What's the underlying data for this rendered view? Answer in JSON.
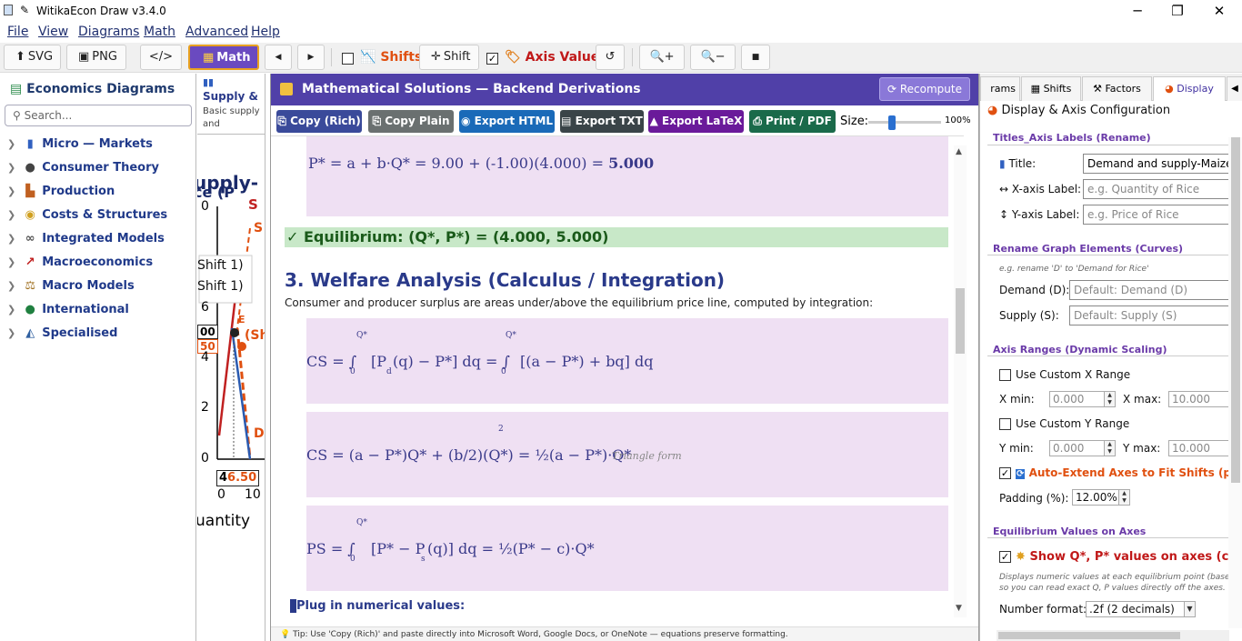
{
  "window": {
    "title": "WitikaEcon Draw  v3.4.0"
  },
  "menu": [
    "File",
    "View",
    "Diagrams",
    "Math",
    "Advanced",
    "Help"
  ],
  "toolbar": {
    "svg": "SVG",
    "png": "PNG",
    "code": "</>",
    "math": "Math",
    "shifts": "Shifts",
    "shift": "Shift",
    "axis_values": "Axis Values"
  },
  "sidebar": {
    "title": "Economics Diagrams",
    "search_placeholder": "Search...",
    "items": [
      {
        "label": "Micro — Markets",
        "icon": "bar-chart-icon"
      },
      {
        "label": "Consumer Theory",
        "icon": "person-icon"
      },
      {
        "label": "Production",
        "icon": "factory-icon"
      },
      {
        "label": "Costs & Structures",
        "icon": "coins-icon"
      },
      {
        "label": "Integrated Models",
        "icon": "link-icon"
      },
      {
        "label": "Macroeconomics",
        "icon": "trend-chart-icon"
      },
      {
        "label": "Macro Models",
        "icon": "scales-icon"
      },
      {
        "label": "International",
        "icon": "globe-icon"
      },
      {
        "label": "Specialised",
        "icon": "area-chart-icon"
      }
    ]
  },
  "diagram_strip": {
    "card_title": "Supply &",
    "card_desc1": "Basic supply",
    "card_desc2": "and",
    "chart_title_frag": "upply-",
    "chart_title_frag2": "ce (P",
    "legend1": "Shift 1)",
    "legend2": "Shift 1)",
    "label_s": "S",
    "label_s2": "S",
    "label_e1": "E",
    "label_sh": "(Sh",
    "label_d": "D",
    "y_ticks": [
      "0",
      "2",
      "4",
      "6"
    ],
    "y_tick_top": "0",
    "val_00": "00",
    "val_50": "50",
    "val_650": "6.50",
    "val_4": "4",
    "x_ticks": [
      "0",
      "10"
    ],
    "x_label": "uantity"
  },
  "math": {
    "header": "Mathematical Solutions  —  Backend Derivations",
    "recompute": "Recompute",
    "actions": [
      "Copy (Rich)",
      "Copy Plain",
      "Export HTML",
      "Export TXT",
      "Export LaTeX",
      "Print / PDF"
    ],
    "size_label": "Size:",
    "size_pct": "100%",
    "p_eq": "P* = a + b·Q* = 9.00 + (-1.00)(4.000) = ",
    "p_eq_bold": "5.000",
    "equilibrium": "✓ Equilibrium: (Q*, P*) = (4.000, 5.000)",
    "section3_title": "3. Welfare Analysis (Calculus / Integration)",
    "section3_desc": "Consumer and producer surplus are areas under/above the equilibrium price line, computed by integration:",
    "cs1_main": "CS = ∫",
    "cs1_a": "[P",
    "cs1_b": "(q) − P*] dq = ∫",
    "cs1_c": "[(a − P*) + bq] dq",
    "cs2_main": "CS = (a − P*)Q* + (b/2)(Q*)",
    "cs2_b": " = ½(a − P*)·Q*",
    "cs2_note": "Triangle form",
    "ps_main": "PS = ∫",
    "ps_a": "[P* − P",
    "ps_b": "(q)] dq = ½(P* − c)·Q*",
    "sup_q": "Q*",
    "sub_0": "0",
    "sub_d": "d",
    "sub_s": "s",
    "sup_2": "2",
    "plug": "Plug in numerical values:",
    "tip": "Tip: Use 'Copy (Rich)' and paste directly into Microsoft Word, Google Docs, or OneNote — equations preserve formatting."
  },
  "right": {
    "tabs": [
      "rams",
      "Shifts",
      "Factors",
      "Display"
    ],
    "title": "Display & Axis Configuration",
    "g1": "Titles_Axis Labels (Rename)",
    "title_lbl": "Title:",
    "title_val": "Demand and supply-Maize in",
    "xlbl": "↔ X-axis Label:",
    "xlbl_ph": "e.g. Quantity of Rice",
    "ylbl": "↕ Y-axis Label:",
    "ylbl_ph": "e.g. Price of Rice",
    "g2": "Rename Graph Elements (Curves)",
    "g2_hint": "e.g. rename 'D' to 'Demand for Rice'",
    "demand_lbl": "Demand (D):",
    "demand_ph": "Default: Demand (D)",
    "supply_lbl": "Supply (S):",
    "supply_ph": "Default: Supply (S)",
    "g3": "Axis Ranges (Dynamic Scaling)",
    "custom_x": "Use Custom X Range",
    "xmin_lbl": "X min:",
    "xmin": "0.000",
    "xmax_lbl": "X max:",
    "xmax": "10.000",
    "custom_y": "Use Custom Y Range",
    "ymin_lbl": "Y min:",
    "ymin": "0.000",
    "ymax_lbl": "Y max:",
    "ymax": "10.000",
    "autoextend": "Auto-Extend Axes to Fit Shifts (prev",
    "padding_lbl": "Padding (%):",
    "padding": "12.00%",
    "g4": "Equilibrium Values on Axes",
    "show_q": "Show Q*, P* values on axes (colored",
    "hint1": "Displays numeric values at each equilibrium point (base + s",
    "hint2": "so you can read exact Q, P values directly off the axes.",
    "numfmt_lbl": "Number format:",
    "numfmt": ".2f (2 decimals)"
  },
  "colors": {
    "accent": "#5040a8",
    "math_bg": "#efe0f3",
    "equilibrium_bg": "#c8e8c8",
    "brand_orange": "#e05010"
  }
}
